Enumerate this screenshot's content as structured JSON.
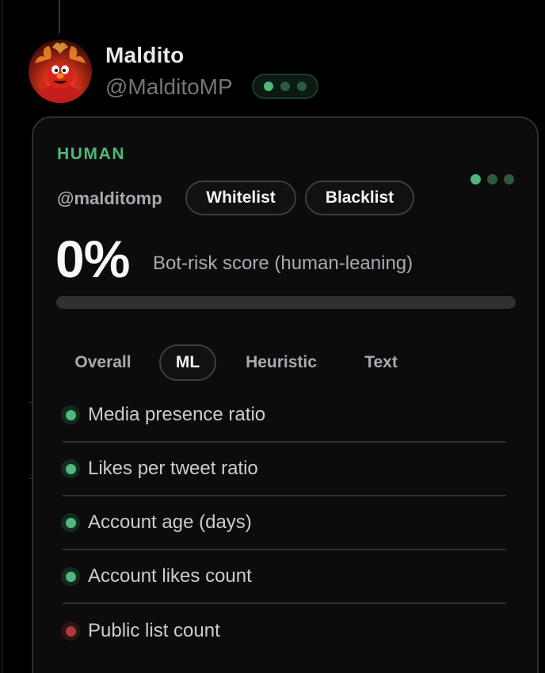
{
  "tweet_author": {
    "display_name": "Maldito",
    "handle": "@MalditoMP"
  },
  "status_pill": {
    "dots": [
      "on",
      "dim",
      "dim"
    ]
  },
  "card": {
    "classification": "HUMAN",
    "handle": "@malditomp",
    "whitelist_label": "Whitelist",
    "blacklist_label": "Blacklist",
    "score": "0%",
    "score_fraction": 0,
    "score_description": "Bot-risk score (human-leaning)",
    "tabs": [
      {
        "label": "Overall",
        "active": false
      },
      {
        "label": "ML",
        "active": true
      },
      {
        "label": "Heuristic",
        "active": false
      },
      {
        "label": "Text",
        "active": false
      }
    ],
    "features": [
      {
        "label": "Media presence ratio",
        "status": "good"
      },
      {
        "label": "Likes per tweet ratio",
        "status": "good"
      },
      {
        "label": "Account age (days)",
        "status": "good"
      },
      {
        "label": "Account likes count",
        "status": "good"
      },
      {
        "label": "Public list count",
        "status": "bad"
      }
    ]
  },
  "colors": {
    "human_green": "#4fb87a",
    "risk_red": "#b23a3a",
    "background": "#000000",
    "card_background": "#0c0c0d"
  }
}
